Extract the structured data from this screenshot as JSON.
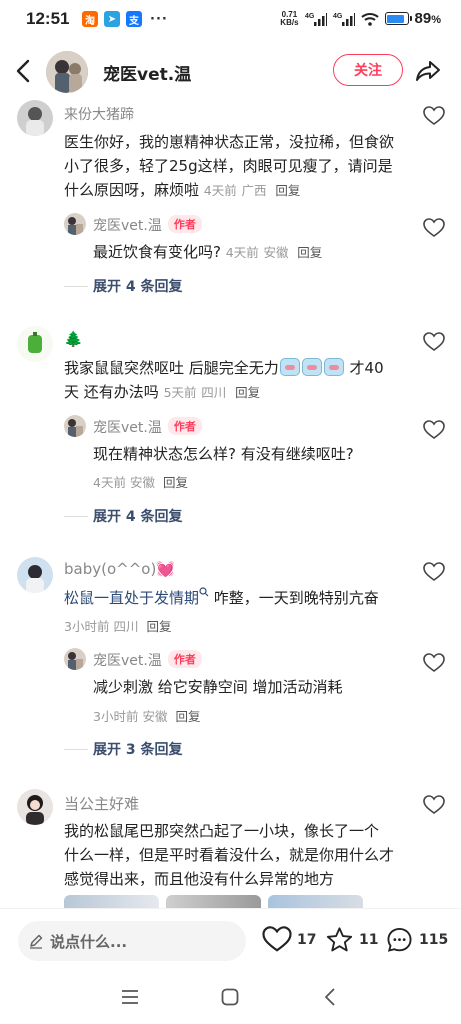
{
  "status_bar": {
    "time": "12:51",
    "net_speed_top": "0.71",
    "net_speed_bottom": "KB/s",
    "signal1": "4G",
    "signal2": "4G",
    "battery_pct": "89",
    "battery_suffix": "%",
    "battery_level": 0.89,
    "app_icons": [
      "taobao-icon",
      "telegram-icon",
      "alipay-icon"
    ]
  },
  "header": {
    "name": "宠医vet.温",
    "follow_label": "关注"
  },
  "comments": [
    {
      "user": "来份大猪蹄",
      "text_line1": "医生你好，我的崽精神状态正常，没拉稀，但食欲",
      "text_line2": "小了很多，轻了25g这样，肉眼可见瘦了，请问是",
      "text_line3": "什么原因呀，麻烦啦",
      "time": "4天前",
      "location": "广西",
      "reply_label": "回复",
      "reply": {
        "user": "宠医vet.温",
        "author_tag": "作者",
        "text": "最近饮食有变化吗?",
        "time": "4天前",
        "location": "安徽",
        "reply_label": "回复"
      },
      "expand_label": "展开 4 条回复"
    },
    {
      "user": "🌲",
      "text_line1_a": "我家鼠鼠突然呕吐 后腿完全无力",
      "text_line1_b": " 才40",
      "text_line2": "天 还有办法吗",
      "time": "5天前",
      "location": "四川",
      "reply_label": "回复",
      "reply": {
        "user": "宠医vet.温",
        "author_tag": "作者",
        "text": "现在精神状态怎么样? 有没有继续呕吐?",
        "time": "4天前",
        "location": "安徽",
        "reply_label": "回复"
      },
      "expand_label": "展开 4 条回复"
    },
    {
      "user": "baby(o^^o)💓",
      "keyword": "松鼠一直处于发情期",
      "text_rest": " 咋整，一天到晚特别亢奋",
      "time": "3小时前",
      "location": "四川",
      "reply_label": "回复",
      "reply": {
        "user": "宠医vet.温",
        "author_tag": "作者",
        "text": "减少刺激 给它安静空间 增加活动消耗",
        "time": "3小时前",
        "location": "安徽",
        "reply_label": "回复"
      },
      "expand_label": "展开 3 条回复"
    },
    {
      "user": "当公主好难",
      "text_line1": "我的松鼠尾巴那突然凸起了一小块，像长了一个",
      "text_line2": "什么一样，但是平时看着没什么，就是你用什么才",
      "text_line3": "感觉得出来，而且他没有什么异常的地方"
    }
  ],
  "bottom_bar": {
    "input_placeholder": "说点什么...",
    "likes": "17",
    "stars": "11",
    "comments": "115"
  },
  "colors": {
    "accent": "#ff3d5a",
    "expand_text": "#3b4e6e",
    "meta_grey": "#999999"
  }
}
